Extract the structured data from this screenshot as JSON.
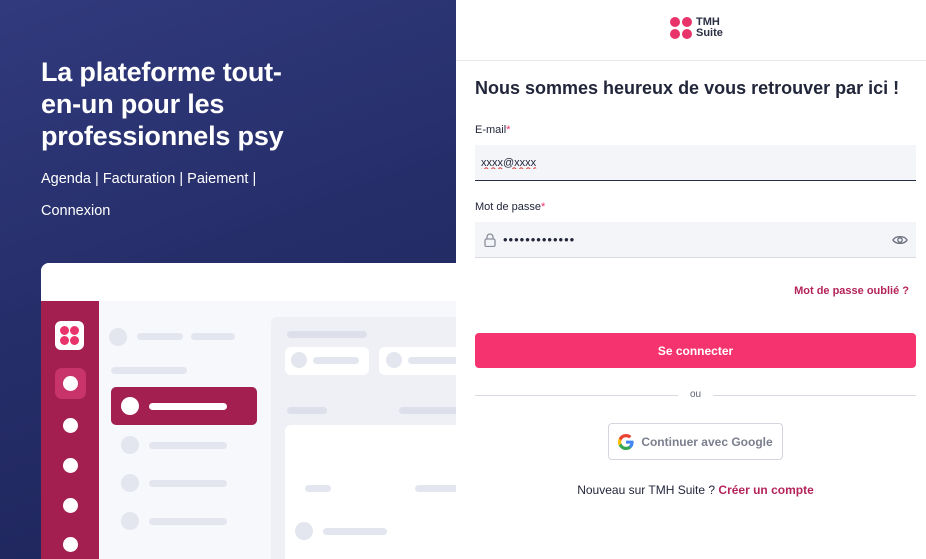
{
  "hero": {
    "title": "La plateforme tout-en-un pour les professionnels psy",
    "subtitle": "Agenda | Facturation | Paiement | Connexion"
  },
  "brand": {
    "line1": "TMH",
    "line2": "Suite",
    "accent_color": "#f5336e",
    "dark_accent": "#a21f4f"
  },
  "login": {
    "heading": "Nous sommes heureux de vous retrouver par ici !",
    "email_label": "E-mail",
    "email_value": "xxxx@xxxx",
    "password_label": "Mot de passe",
    "password_value": "•••••••••••••",
    "required_mark": "*",
    "forgot_link": "Mot de passe oublié ?",
    "submit_label": "Se connecter",
    "separator": "ou",
    "google_label": "Continuer avec Google",
    "signup_prompt": "Nouveau sur TMH Suite ?",
    "signup_link": "Créer un compte"
  },
  "icons": {
    "password_prefix": "lock-icon",
    "password_suffix": "eye-icon",
    "google": "google-icon"
  }
}
